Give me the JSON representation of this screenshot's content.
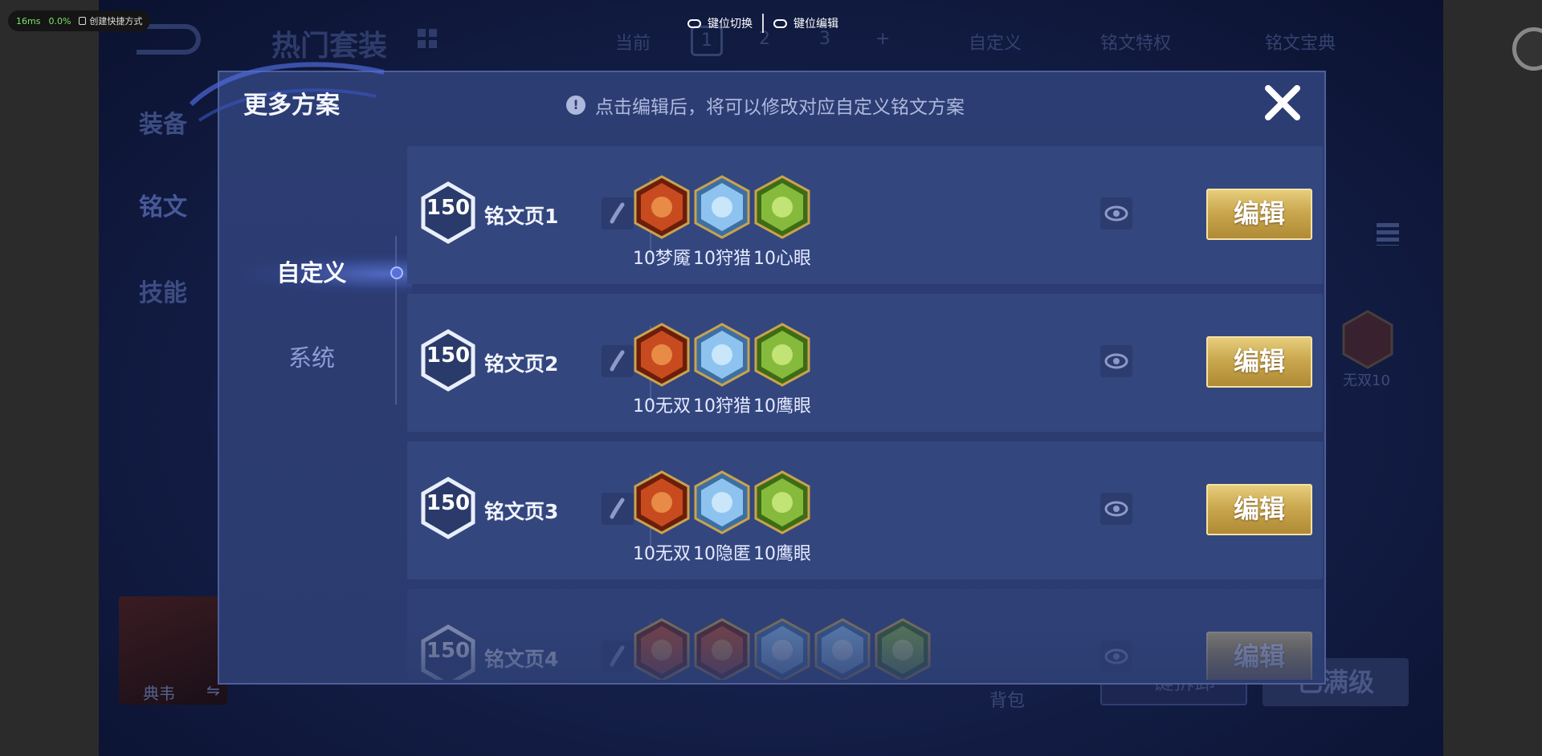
{
  "overlay": {
    "latency": "16ms",
    "cpu": "0.0%",
    "shortcut_label": "创建快捷方式",
    "key_switch": "键位切换",
    "key_edit": "键位编辑"
  },
  "background": {
    "title": "热门套装",
    "tabs": [
      "当前",
      "1",
      "2",
      "3",
      "+"
    ],
    "custom": "自定义",
    "privilege": "铭文特权",
    "codex": "铭文宝典",
    "side": [
      "装备",
      "铭文",
      "技能"
    ],
    "hero_name": "典韦",
    "bag": "背包",
    "btn_one_key": "一键拆卸",
    "btn_max": "已满级",
    "side_rune_label": "无双10"
  },
  "modal": {
    "title": "更多方案",
    "tip": "点击编辑后，将可以修改对应自定义铭文方案",
    "tabs": {
      "custom": "自定义",
      "system": "系统"
    },
    "pages": [
      {
        "level": "150",
        "name": "铭文页1",
        "runes": [
          {
            "label": "10梦魇",
            "color": "red",
            "icon": "nightmare-rune-icon"
          },
          {
            "label": "10狩猎",
            "color": "blue",
            "icon": "hunt-rune-icon"
          },
          {
            "label": "10心眼",
            "color": "green",
            "icon": "insight-rune-icon"
          }
        ],
        "edit": "编辑"
      },
      {
        "level": "150",
        "name": "铭文页2",
        "runes": [
          {
            "label": "10无双",
            "color": "red",
            "icon": "peerless-rune-icon"
          },
          {
            "label": "10狩猎",
            "color": "blue",
            "icon": "hunt-rune-icon"
          },
          {
            "label": "10鹰眼",
            "color": "green",
            "icon": "eagle-eye-rune-icon"
          }
        ],
        "edit": "编辑"
      },
      {
        "level": "150",
        "name": "铭文页3",
        "runes": [
          {
            "label": "10无双",
            "color": "red",
            "icon": "peerless-rune-icon"
          },
          {
            "label": "10隐匿",
            "color": "blue",
            "icon": "stealth-rune-icon"
          },
          {
            "label": "10鹰眼",
            "color": "green",
            "icon": "eagle-eye-rune-icon"
          }
        ],
        "edit": "编辑"
      },
      {
        "level": "150",
        "name": "铭文页4",
        "runes": [
          {
            "label": "",
            "color": "red",
            "icon": "red-rune-icon"
          },
          {
            "label": "",
            "color": "red",
            "icon": "red-rune-icon"
          },
          {
            "label": "",
            "color": "blue",
            "icon": "blue-rune-icon"
          },
          {
            "label": "",
            "color": "blue",
            "icon": "blue-rune-icon"
          },
          {
            "label": "",
            "color": "green",
            "icon": "green-rune-icon"
          }
        ],
        "edit": "编辑"
      }
    ]
  },
  "colors": {
    "gold": "#caa84f",
    "panel": "#2c3d73",
    "row": "#33467e",
    "red_rune": "#c4471e",
    "blue_rune": "#7fb3e8",
    "green_rune": "#84b83a"
  }
}
